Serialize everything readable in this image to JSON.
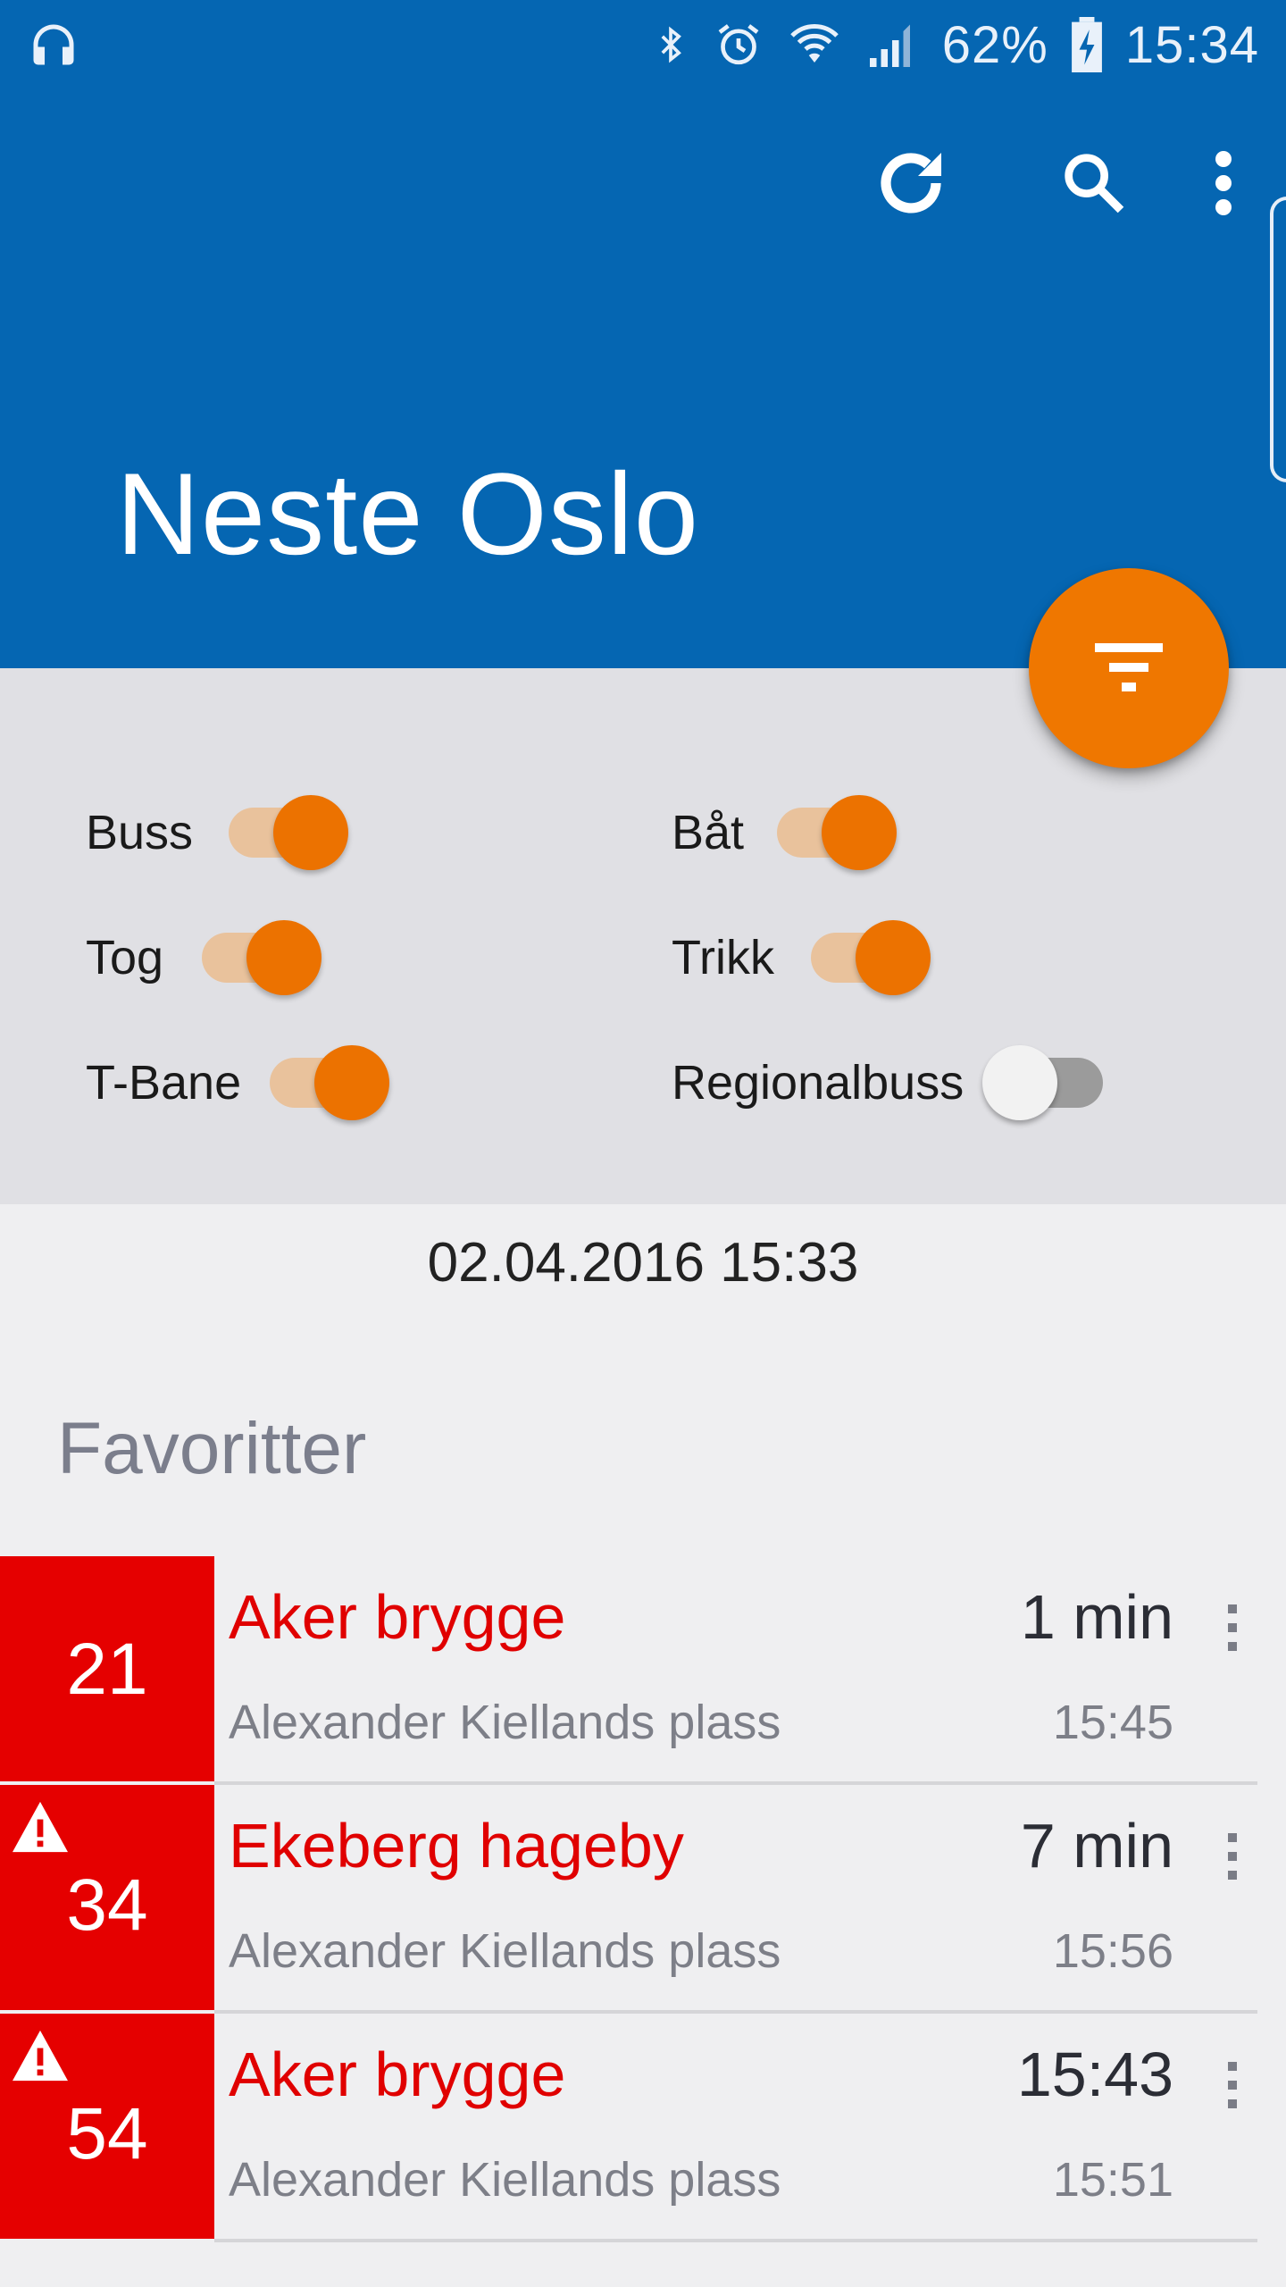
{
  "status_bar": {
    "battery": "62%",
    "clock": "15:34",
    "icons": [
      "headphones-icon",
      "bluetooth-icon",
      "alarm-icon",
      "wifi-icon",
      "signal-icon",
      "battery-charging-icon"
    ]
  },
  "toolbar": {
    "title": "Neste Oslo",
    "actions": [
      "refresh-icon",
      "search-icon",
      "more-vert-icon"
    ]
  },
  "fab": {
    "icon": "filter-icon",
    "color": "#ef7700"
  },
  "filters": {
    "buss": {
      "label": "Buss",
      "on": true
    },
    "tog": {
      "label": "Tog",
      "on": true
    },
    "tbane": {
      "label": "T-Bane",
      "on": true
    },
    "baat": {
      "label": "Båt",
      "on": true
    },
    "trikk": {
      "label": "Trikk",
      "on": true
    },
    "regionalbuss": {
      "label": "Regionalbuss",
      "on": false
    }
  },
  "timestamp": "02.04.2016 15:33",
  "favorites": {
    "title": "Favoritter",
    "rows": [
      {
        "line": "21",
        "destination": "Aker brygge",
        "stop": "Alexander Kiellands plass",
        "eta": "1 min",
        "scheduled": "15:45",
        "warning": false
      },
      {
        "line": "34",
        "destination": "Ekeberg hageby",
        "stop": "Alexander Kiellands plass",
        "eta": "7 min",
        "scheduled": "15:56",
        "warning": true
      },
      {
        "line": "54",
        "destination": "Aker brygge",
        "stop": "Alexander Kiellands plass",
        "eta": "15:43",
        "scheduled": "15:51",
        "warning": true
      }
    ]
  },
  "colors": {
    "primary": "#0566b2",
    "accent": "#ef7700",
    "line_badge": "#e50000",
    "destination_text": "#e00000"
  }
}
